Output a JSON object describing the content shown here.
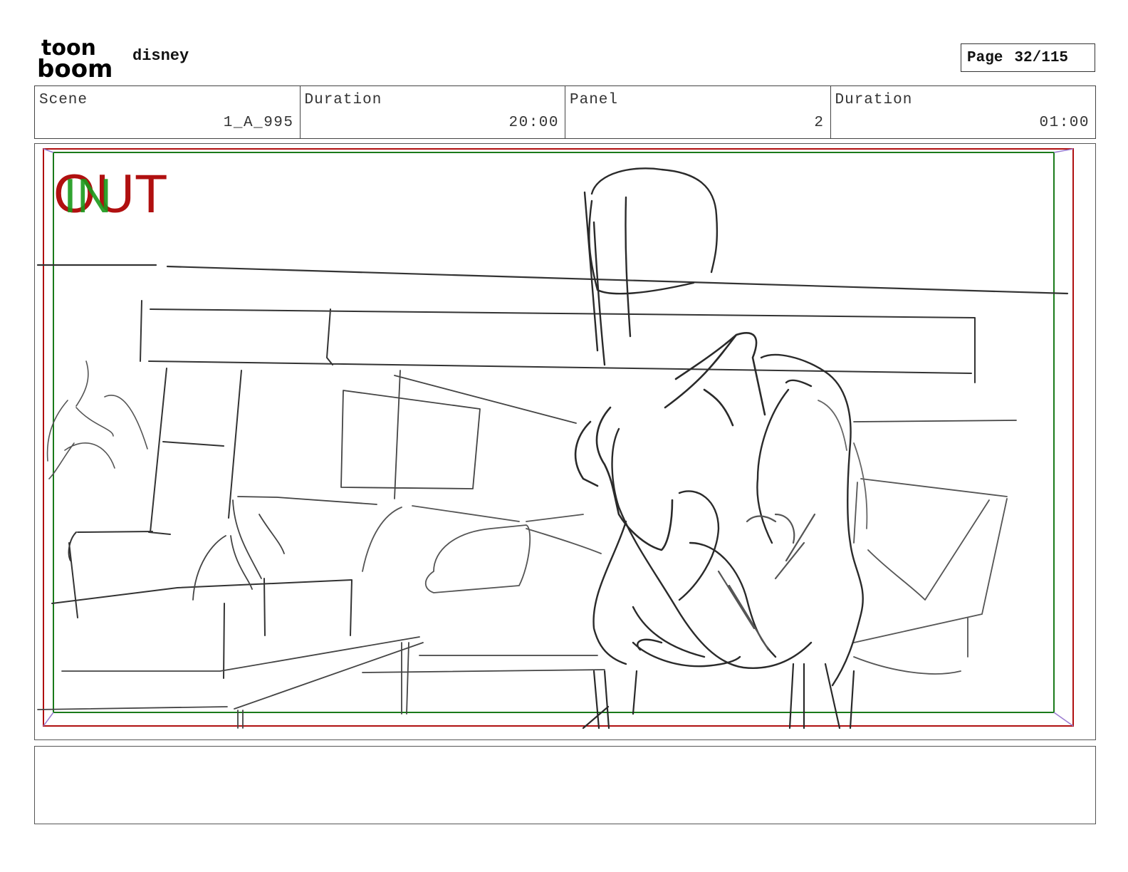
{
  "header": {
    "logo_top": "toon",
    "logo_bottom": "boom",
    "project": "disney",
    "page_label": "Page",
    "page_number": "32/115"
  },
  "info": {
    "scene_label": "Scene",
    "scene_value": "1_A_995",
    "scene_duration_label": "Duration",
    "scene_duration_value": "20:00",
    "panel_label": "Panel",
    "panel_value": "2",
    "panel_duration_label": "Duration",
    "panel_duration_value": "01:00"
  },
  "panel": {
    "out_label": "OUT",
    "in_label": "IN",
    "colors": {
      "out": "#b01010",
      "in": "#1a9a1a",
      "sketch": "#333333"
    }
  },
  "caption": {
    "text": ""
  }
}
